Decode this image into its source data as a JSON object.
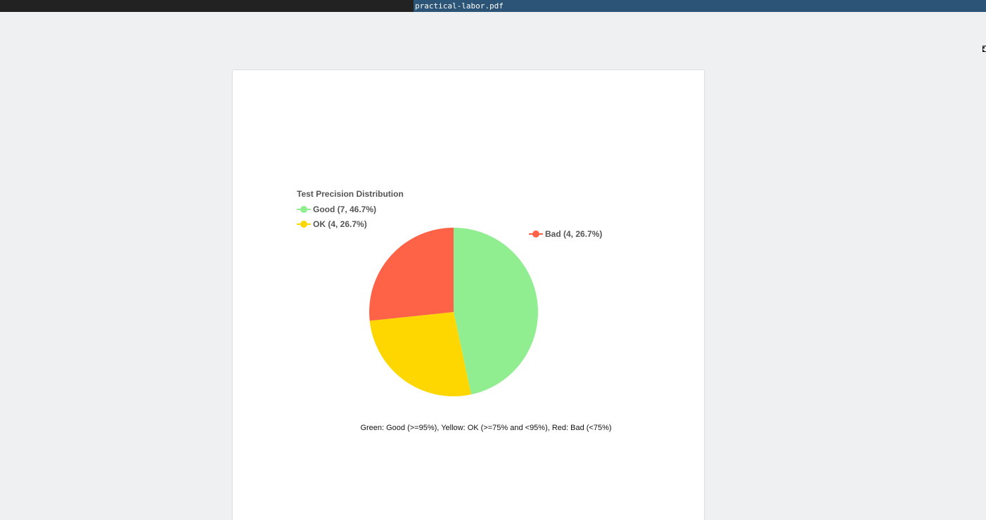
{
  "window": {
    "file_name": "practical-labor.pdf"
  },
  "toolbar": {
    "fit_icon": "fit-to-page-icon"
  },
  "colors": {
    "good": "#90ee90",
    "ok": "#ffd700",
    "bad": "#ff6347",
    "legend_text": "#555555"
  },
  "chart_data": {
    "type": "pie",
    "title": "Test Precision Distribution",
    "categories": [
      "Good",
      "OK",
      "Bad"
    ],
    "values": [
      7,
      4,
      4
    ],
    "percentages": [
      46.7,
      26.7,
      26.7
    ],
    "colors": [
      "#90ee90",
      "#ffd700",
      "#ff6347"
    ],
    "legend_labels": [
      "Good (7, 46.7%)",
      "OK (4, 26.7%)",
      "Bad (4, 26.7%)"
    ],
    "legend_placement": "top-left and top-right",
    "caption": "Green: Good (>=95%), Yellow: OK (>=75% and <95%), Red: Bad (<75%)"
  }
}
